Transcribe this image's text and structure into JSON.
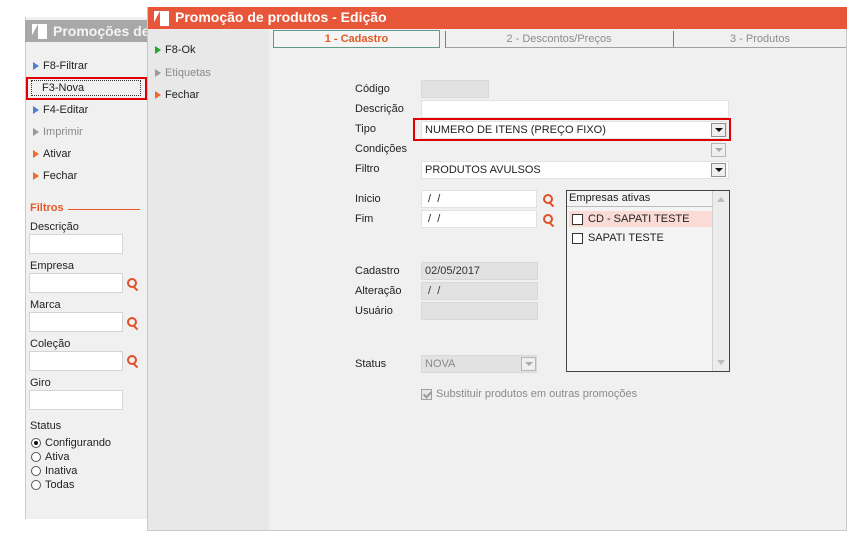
{
  "bg_window": {
    "title": "Promoções de produtos",
    "menu": [
      {
        "label": "F8-Filtrar",
        "icon": "blue-triangle-icon",
        "enabled": true
      },
      {
        "label": "F3-Nova",
        "icon": "none",
        "enabled": true
      },
      {
        "label": "F4-Editar",
        "icon": "blue-triangle-icon",
        "enabled": true
      },
      {
        "label": "Imprimir",
        "icon": "gray-triangle-icon",
        "enabled": false
      },
      {
        "label": "Ativar",
        "icon": "orange-triangle-icon",
        "enabled": true
      },
      {
        "label": "Fechar",
        "icon": "orange-triangle-icon",
        "enabled": true
      }
    ],
    "filters": {
      "section_title": "Filtros",
      "descricao_label": "Descrição",
      "empresa_label": "Empresa",
      "marca_label": "Marca",
      "colecao_label": "Coleção",
      "giro_label": "Giro",
      "status_label": "Status",
      "status_options": [
        "Configurando",
        "Ativa",
        "Inativa",
        "Todas"
      ],
      "status_selected": "Configurando"
    }
  },
  "main_window": {
    "title": "Promoção de produtos - Edição",
    "title_color": "#e8563a",
    "left_menu": [
      {
        "label": "F8-Ok",
        "icon": "green-triangle-icon",
        "enabled": true
      },
      {
        "label": "Etiquetas",
        "icon": "gray-triangle-icon",
        "enabled": false
      },
      {
        "label": "Fechar",
        "icon": "orange-triangle-icon",
        "enabled": true
      }
    ],
    "tabs": [
      {
        "label": "1 - Cadastro",
        "active": true
      },
      {
        "label": "2 - Descontos/Preços",
        "active": false
      },
      {
        "label": "3 - Produtos",
        "active": false
      }
    ],
    "form": {
      "codigo_label": "Código",
      "codigo_value": "",
      "descricao_label": "Descrição",
      "descricao_value": "",
      "tipo_label": "Tipo",
      "tipo_value": "NUMERO DE ITENS (PREÇO FIXO)",
      "condicoes_label": "Condições",
      "condicoes_value": "",
      "filtro_label": "Filtro",
      "filtro_value": "PRODUTOS AVULSOS",
      "inicio_label": "Inicio",
      "inicio_value": " /  /",
      "fim_label": "Fim",
      "fim_value": " /  /",
      "cadastro_label": "Cadastro",
      "cadastro_value": "02/05/2017",
      "alteracao_label": "Alteração",
      "alteracao_value": " /  /",
      "usuario_label": "Usuário",
      "usuario_value": "",
      "status_label": "Status",
      "status_value": "NOVA",
      "substituir_label": "Substituir produtos em outras promoções",
      "substituir_checked": true
    },
    "empresas": {
      "header": "Empresas ativas",
      "items": [
        {
          "label": "CD - SAPATI TESTE",
          "checked": false,
          "selected": true
        },
        {
          "label": "SAPATI TESTE",
          "checked": false,
          "selected": false
        }
      ]
    }
  },
  "colors": {
    "accent_orange": "#e8563a",
    "highlight_red": "#e00000",
    "bg_title_gray": "#a8a8a8"
  }
}
